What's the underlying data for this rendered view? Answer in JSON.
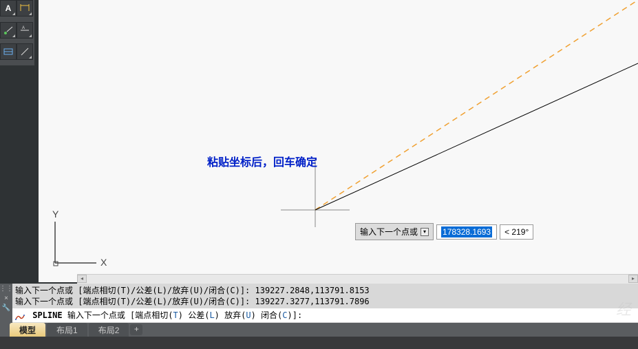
{
  "toolbar": {
    "tools": [
      "A",
      "dim",
      "dot",
      "align",
      "rect",
      "slash"
    ]
  },
  "canvas": {
    "axis_x": "X",
    "axis_y": "Y"
  },
  "annotation": "粘贴坐标后，回车确定",
  "dynamic_input": {
    "prompt": "输入下一个点或",
    "coord": "178328.1693",
    "angle": "< 219°"
  },
  "command": {
    "history": [
      "输入下一个点或 [端点相切(T)/公差(L)/放弃(U)/闭合(C)]: 139227.2848,113791.8153",
      "输入下一个点或 [端点相切(T)/公差(L)/放弃(U)/闭合(C)]: 139227.3277,113791.7896"
    ],
    "cmd_name": "SPLINE",
    "cmd_prompt": "输入下一个点或 [",
    "opt1_pre": "端点相切(",
    "opt1_key": "T",
    "opt1_post": ")",
    "opt2_pre": " 公差(",
    "opt2_key": "L",
    "opt2_post": ")",
    "opt3_pre": " 放弃(",
    "opt3_key": "U",
    "opt3_post": ")",
    "opt4_pre": " 闭合(",
    "opt4_key": "C",
    "opt4_post": ")]:"
  },
  "tabs": {
    "items": [
      "模型",
      "布局1",
      "布局2"
    ],
    "add": "+"
  },
  "watermark": "经"
}
